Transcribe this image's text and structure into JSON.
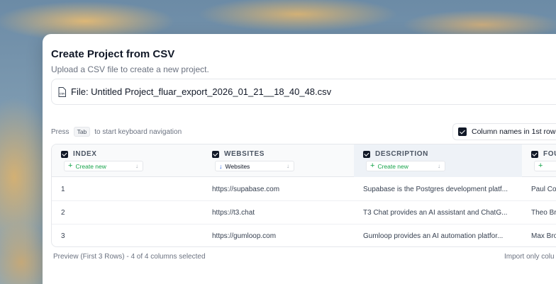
{
  "modal": {
    "title": "Create Project from CSV",
    "subtitle": "Upload a CSV file to create a new project.",
    "file_label": "File: Untitled Project_fluar_export_2026_01_21__18_40_48.csv"
  },
  "hint": {
    "press": "Press",
    "key": "Tab",
    "rest": "to start keyboard navigation"
  },
  "column_names_toggle": {
    "label": "Column names in 1st row",
    "checked": true
  },
  "table": {
    "columns": [
      {
        "label": "INDEX",
        "mapping": "Create new",
        "mapping_type": "create"
      },
      {
        "label": "WEBSITES",
        "mapping": "Websites",
        "mapping_type": "existing"
      },
      {
        "label": "DESCRIPTION",
        "mapping": "Create new",
        "mapping_type": "create"
      },
      {
        "label": "FOU",
        "mapping": "",
        "mapping_type": "create"
      }
    ],
    "rows": [
      [
        "1",
        "https://supabase.com",
        "Supabase is the Postgres development platf...",
        "Paul Co"
      ],
      [
        "2",
        "https://t3.chat",
        "T3 Chat provides an AI assistant and ChatG...",
        "Theo Br"
      ],
      [
        "3",
        "https://gumloop.com",
        "Gumloop provides an AI automation platfor...",
        "Max Bro"
      ]
    ]
  },
  "footer": {
    "preview": "Preview (First 3 Rows) - 4 of 4 columns selected",
    "import_only": "Import only colu"
  }
}
